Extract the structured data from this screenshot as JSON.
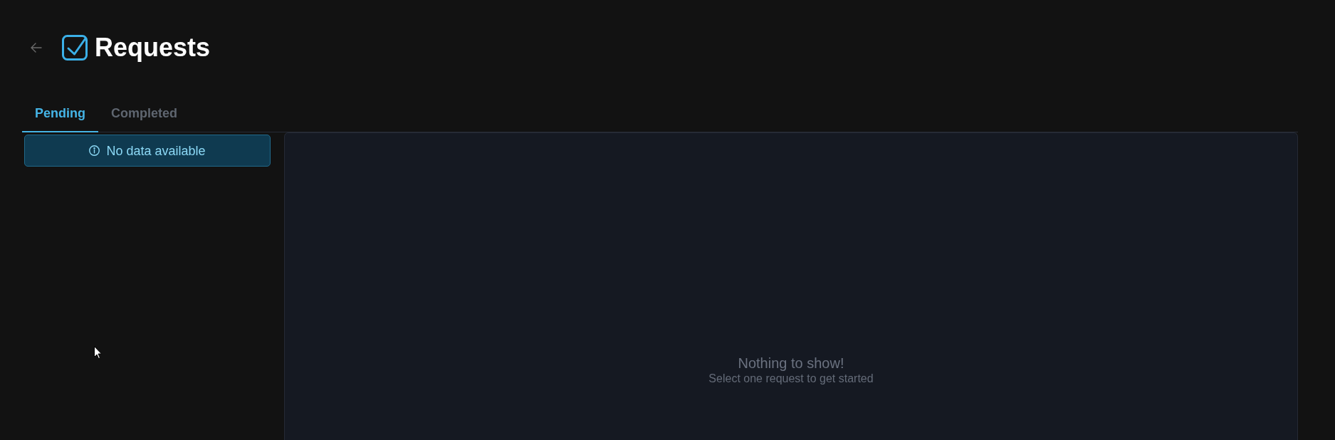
{
  "header": {
    "title": "Requests"
  },
  "tabs": [
    {
      "label": "Pending",
      "selected": true
    },
    {
      "label": "Completed",
      "selected": false
    }
  ],
  "list": {
    "alert": {
      "kind": "info",
      "message": "No data available"
    }
  },
  "detail": {
    "empty_state": {
      "title": "Nothing to show!",
      "subtitle": "Select one request to get started"
    }
  }
}
